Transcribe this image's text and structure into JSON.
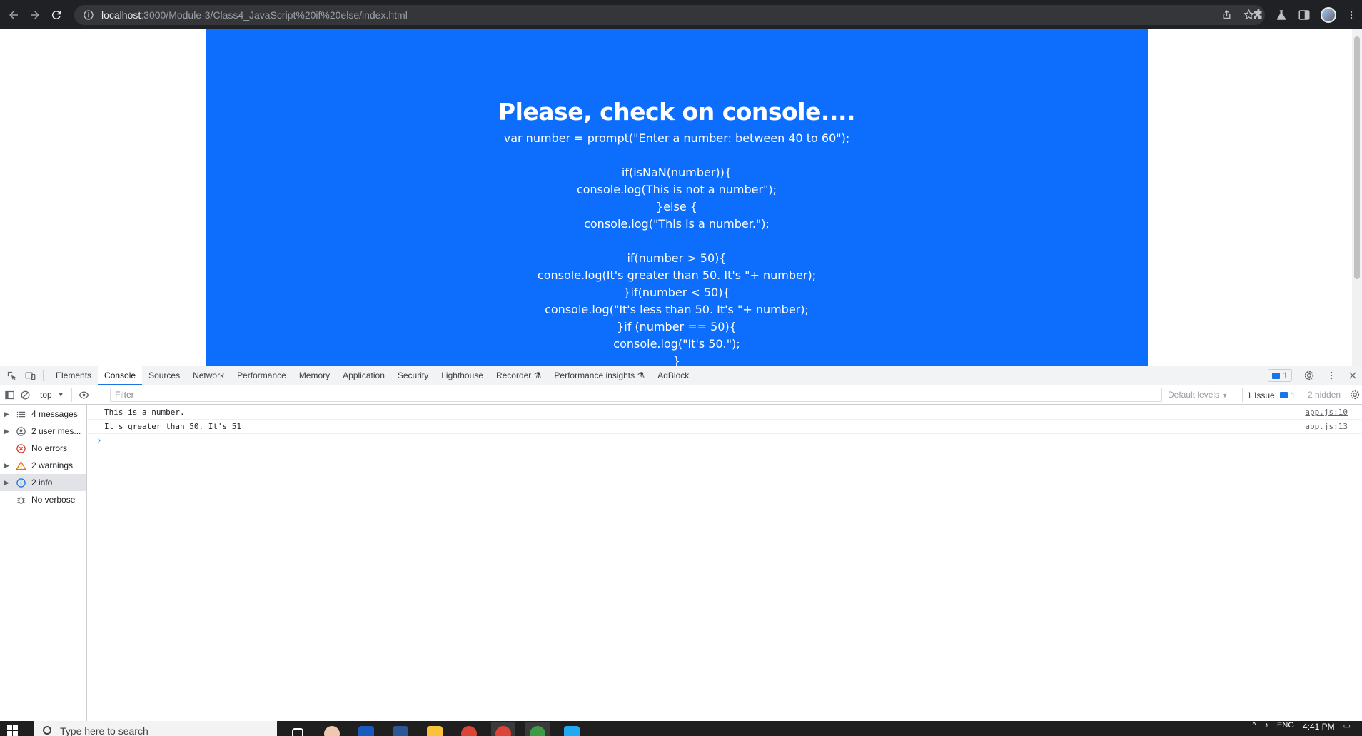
{
  "browser": {
    "url_host": "localhost",
    "url_path": ":3000/Module-3/Class4_JavaScript%20if%20else/index.html"
  },
  "page": {
    "heading": "Please, check on console....",
    "code_lines": [
      "var number = prompt(\"Enter a number: between 40 to 60\");",
      "",
      "if(isNaN(number)){",
      "console.log(This is not a number\");",
      "}else {",
      "console.log(\"This is a number.\");",
      "",
      "if(number > 50){",
      "console.log(It's greater than 50. It's \"+ number);",
      "}if(number < 50){",
      "console.log(\"It's less than 50. It's \"+ number);",
      "}if (number == 50){",
      "console.log(\"It's 50.\");",
      "}"
    ],
    "hero_color": "#0d6efd"
  },
  "devtools": {
    "tabs": [
      "Elements",
      "Console",
      "Sources",
      "Network",
      "Performance",
      "Memory",
      "Application",
      "Security",
      "Lighthouse",
      "Recorder",
      "Performance insights",
      "AdBlock"
    ],
    "active_tab": "Console",
    "issue_badge": "1",
    "toolbar": {
      "context": "top",
      "filter_placeholder": "Filter",
      "levels": "Default levels",
      "issues_label": "1 Issue:",
      "issues_count": "1",
      "hidden_label": "2 hidden"
    },
    "sidebar": [
      {
        "label": "4 messages",
        "icon": "list-icon",
        "expandable": true
      },
      {
        "label": "2 user mes...",
        "icon": "user-icon",
        "expandable": true
      },
      {
        "label": "No errors",
        "icon": "error-icon",
        "expandable": false
      },
      {
        "label": "2 warnings",
        "icon": "warning-icon",
        "expandable": true
      },
      {
        "label": "2 info",
        "icon": "info-icon",
        "expandable": true
      },
      {
        "label": "No verbose",
        "icon": "bug-icon",
        "expandable": false
      }
    ],
    "messages": [
      {
        "text": "This is a number.",
        "source": "app.js:10"
      },
      {
        "text": "It's greater than 50. It's 51",
        "source": "app.js:13"
      }
    ]
  },
  "taskbar": {
    "search_placeholder": "Type here to search",
    "language": "ENG",
    "time": "4:41 PM"
  }
}
